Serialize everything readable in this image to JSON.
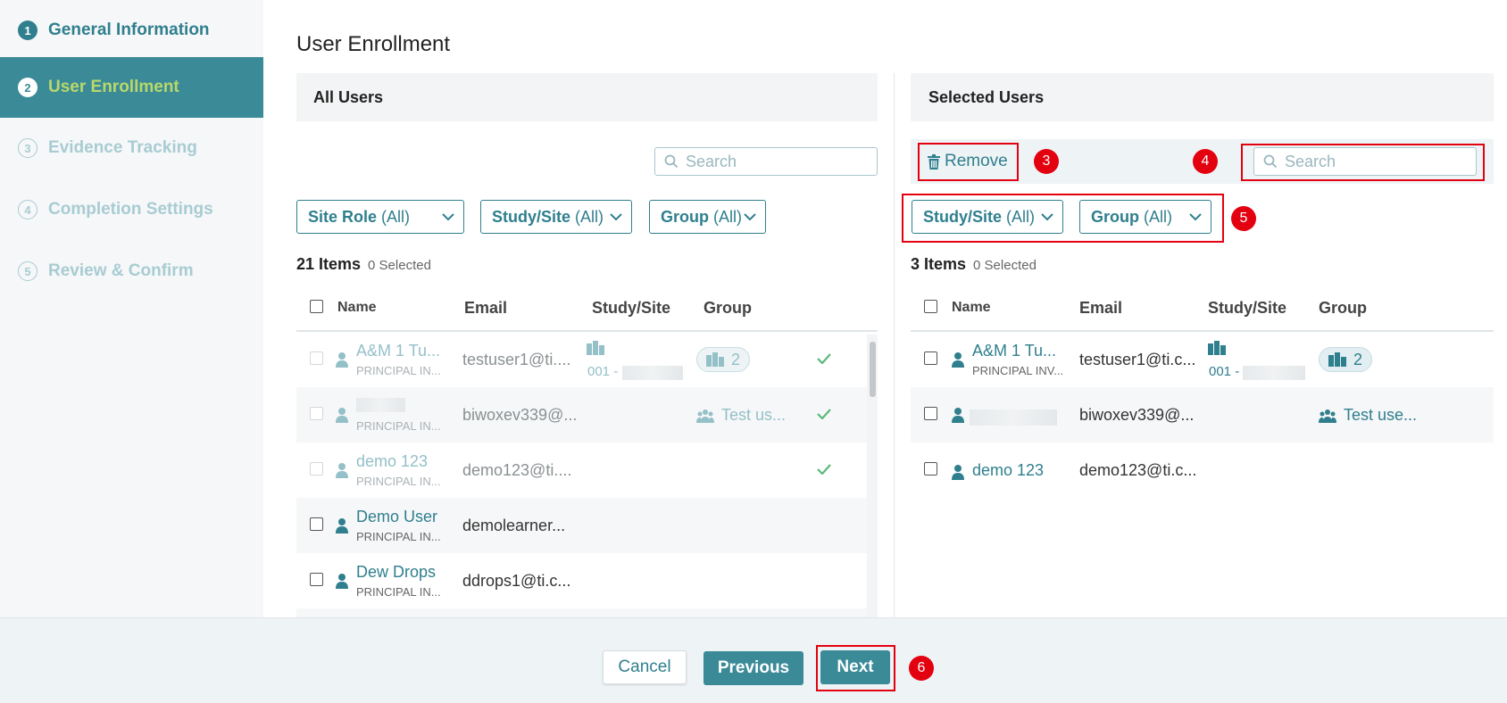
{
  "sidebar": {
    "steps": [
      {
        "num": "1",
        "label": "General Information"
      },
      {
        "num": "2",
        "label": "User Enrollment"
      },
      {
        "num": "3",
        "label": "Evidence Tracking"
      },
      {
        "num": "4",
        "label": "Completion Settings"
      },
      {
        "num": "5",
        "label": "Review & Confirm"
      }
    ]
  },
  "main": {
    "title": "User Enrollment"
  },
  "all_users": {
    "header": "All Users",
    "search_placeholder": "Search",
    "filters": [
      {
        "name": "Site Role",
        "value": "(All)"
      },
      {
        "name": "Study/Site",
        "value": "(All)"
      },
      {
        "name": "Group",
        "value": "(All)"
      }
    ],
    "count": "21 Items",
    "selected": "0 Selected",
    "columns": [
      "Name",
      "Email",
      "Study/Site",
      "Group"
    ],
    "rows": [
      {
        "name": "A&M 1 Tu...",
        "role": "PRINCIPAL IN...",
        "email": "testuser1@ti....",
        "site_code": "001 -",
        "group": "2"
      },
      {
        "name": "",
        "role": "PRINCIPAL IN...",
        "email": "biwoxev339@...",
        "group": "Test us..."
      },
      {
        "name": "demo 123",
        "role": "PRINCIPAL IN...",
        "email": "demo123@ti...."
      },
      {
        "name": "Demo User",
        "role": "PRINCIPAL IN...",
        "email": "demolearner..."
      },
      {
        "name": "Dew Drops",
        "role": "PRINCIPAL IN...",
        "email": "ddrops1@ti.c..."
      }
    ]
  },
  "selected_users": {
    "header": "Selected Users",
    "remove_label": "Remove",
    "search_placeholder": "Search",
    "filters": [
      {
        "name": "Study/Site",
        "value": "(All)"
      },
      {
        "name": "Group",
        "value": "(All)"
      }
    ],
    "count": "3 Items",
    "selected": "0 Selected",
    "columns": [
      "Name",
      "Email",
      "Study/Site",
      "Group"
    ],
    "rows": [
      {
        "name": "A&M 1 Tu...",
        "role": "PRINCIPAL INV...",
        "email": "testuser1@ti.c...",
        "site_code": "001 -",
        "group": "2"
      },
      {
        "name": "",
        "email": "biwoxev339@...",
        "group": "Test use..."
      },
      {
        "name": "demo 123",
        "email": "demo123@ti.c..."
      }
    ]
  },
  "annotations": [
    "3",
    "4",
    "5",
    "6"
  ],
  "footer": {
    "cancel": "Cancel",
    "previous": "Previous",
    "next": "Next"
  },
  "colors": {
    "accent": "#2f7f8e",
    "active_step_bg": "#3a8a98",
    "active_step_text": "#b8d86a",
    "annotation": "#e3000f",
    "check": "#5cb87a"
  },
  "icons": {
    "search": "search-icon",
    "chevron": "chevron-down-icon",
    "person": "person-icon",
    "site": "building-icon",
    "group": "group-icon",
    "check": "check-icon",
    "trash": "trash-icon"
  }
}
